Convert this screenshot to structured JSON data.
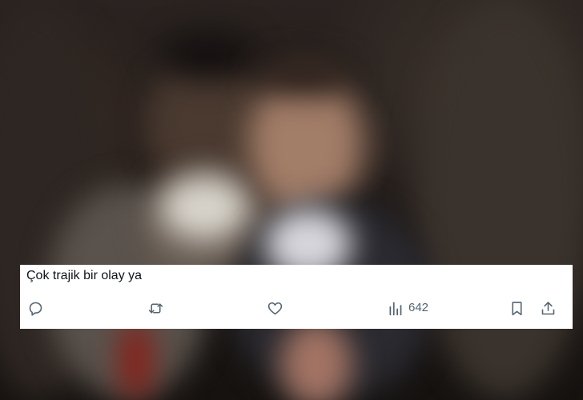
{
  "tweet": {
    "text": "Çok trajik bir olay ya",
    "views_count": "642"
  },
  "icons": {
    "reply": "reply-icon",
    "retweet": "retweet-icon",
    "like": "like-icon",
    "views": "views-icon",
    "bookmark": "bookmark-icon",
    "share": "share-icon"
  },
  "colors": {
    "card_background": "#ffffff",
    "text": "#0f1419",
    "icon": "#536471"
  }
}
